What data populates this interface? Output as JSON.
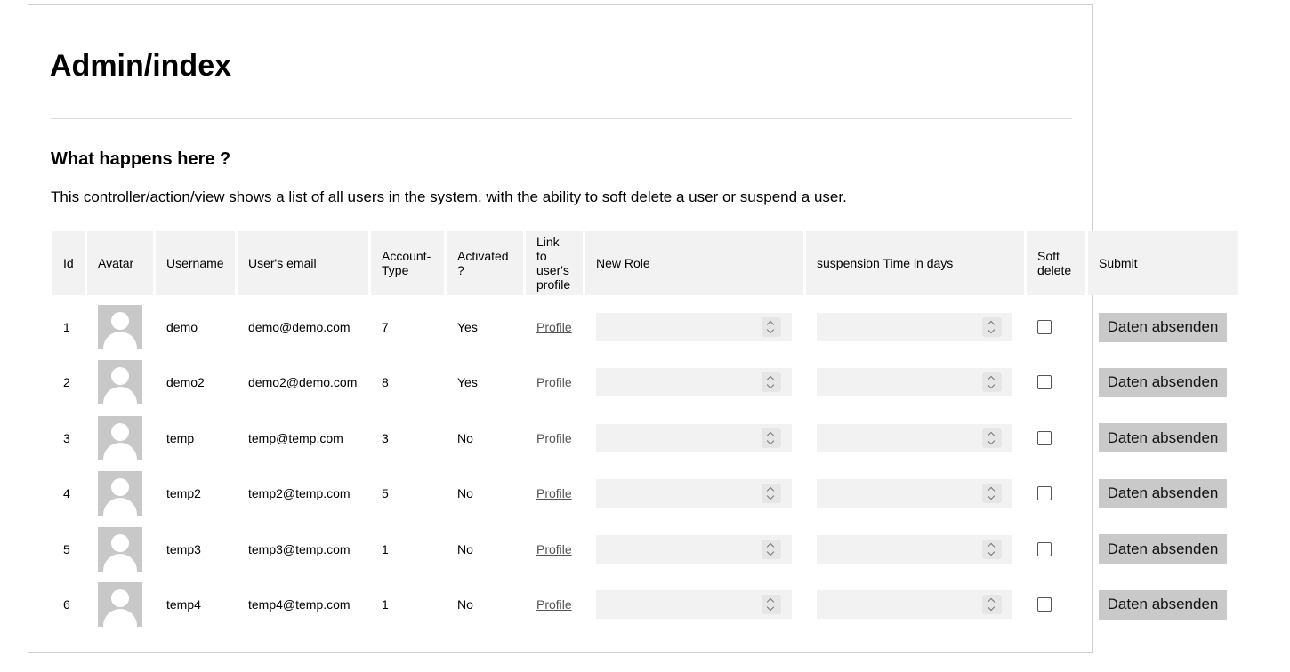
{
  "page": {
    "title": "Admin/index",
    "section_heading": "What happens here ?",
    "description": "This controller/action/view shows a list of all users in the system. with the ability to soft delete a user or suspend a user."
  },
  "table": {
    "headers": {
      "id": "Id",
      "avatar": "Avatar",
      "username": "Username",
      "email": "User's email",
      "account_type": "Account-Type",
      "activated": "Activated ?",
      "profile_link": "Link to user's profile",
      "new_role": "New Role",
      "suspension": "suspension Time in days",
      "soft_delete": "Soft delete",
      "submit": "Submit"
    },
    "rows": [
      {
        "id": "1",
        "username": "demo",
        "email": "demo@demo.com",
        "account_type": "7",
        "activated": "Yes",
        "profile": "Profile",
        "new_role": "",
        "suspension": "",
        "soft_delete": false,
        "submit": "Daten absenden"
      },
      {
        "id": "2",
        "username": "demo2",
        "email": "demo2@demo.com",
        "account_type": "8",
        "activated": "Yes",
        "profile": "Profile",
        "new_role": "",
        "suspension": "",
        "soft_delete": false,
        "submit": "Daten absenden"
      },
      {
        "id": "3",
        "username": "temp",
        "email": "temp@temp.com",
        "account_type": "3",
        "activated": "No",
        "profile": "Profile",
        "new_role": "",
        "suspension": "",
        "soft_delete": false,
        "submit": "Daten absenden"
      },
      {
        "id": "4",
        "username": "temp2",
        "email": "temp2@temp.com",
        "account_type": "5",
        "activated": "No",
        "profile": "Profile",
        "new_role": "",
        "suspension": "",
        "soft_delete": false,
        "submit": "Daten absenden"
      },
      {
        "id": "5",
        "username": "temp3",
        "email": "temp3@temp.com",
        "account_type": "1",
        "activated": "No",
        "profile": "Profile",
        "new_role": "",
        "suspension": "",
        "soft_delete": false,
        "submit": "Daten absenden"
      },
      {
        "id": "6",
        "username": "temp4",
        "email": "temp4@temp.com",
        "account_type": "1",
        "activated": "No",
        "profile": "Profile",
        "new_role": "",
        "suspension": "",
        "soft_delete": false,
        "submit": "Daten absenden"
      }
    ]
  }
}
